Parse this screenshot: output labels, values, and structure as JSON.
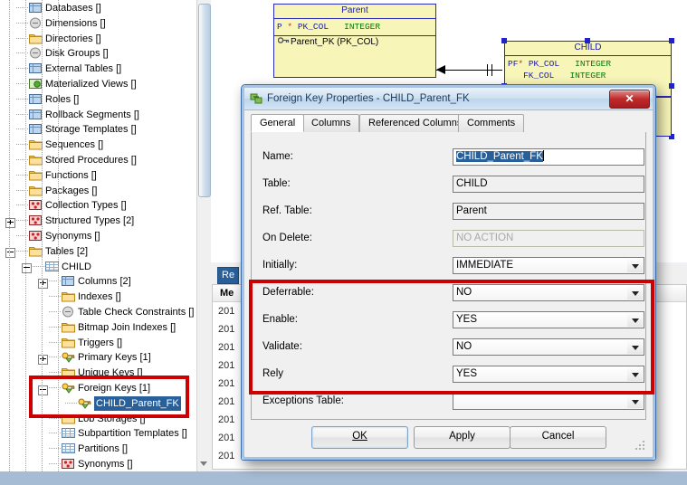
{
  "tree": {
    "items": [
      {
        "label": "Databases []",
        "icon": "databases-icon",
        "indent": 0,
        "toggle": "none",
        "icon_kind": "blue"
      },
      {
        "label": "Dimensions []",
        "icon": "dimensions-icon",
        "indent": 0,
        "toggle": "none",
        "icon_kind": "gray"
      },
      {
        "label": "Directories []",
        "icon": "directories-icon",
        "indent": 0,
        "toggle": "none",
        "icon_kind": "folder"
      },
      {
        "label": "Disk Groups []",
        "icon": "disk-groups-icon",
        "indent": 0,
        "toggle": "none",
        "icon_kind": "gray"
      },
      {
        "label": "External Tables []",
        "icon": "external-tables-icon",
        "indent": 0,
        "toggle": "none",
        "icon_kind": "blue"
      },
      {
        "label": "Materialized Views []",
        "icon": "materialized-views-icon",
        "indent": 0,
        "toggle": "none",
        "icon_kind": "green"
      },
      {
        "label": "Roles []",
        "icon": "roles-icon",
        "indent": 0,
        "toggle": "none",
        "icon_kind": "blue"
      },
      {
        "label": "Rollback Segments []",
        "icon": "rollback-segments-icon",
        "indent": 0,
        "toggle": "none",
        "icon_kind": "blue"
      },
      {
        "label": "Storage Templates []",
        "icon": "storage-templates-icon",
        "indent": 0,
        "toggle": "none",
        "icon_kind": "blue"
      },
      {
        "label": "Sequences []",
        "icon": "sequences-icon",
        "indent": 0,
        "toggle": "none",
        "icon_kind": "folder"
      },
      {
        "label": "Stored Procedures []",
        "icon": "stored-procedures-icon",
        "indent": 0,
        "toggle": "none",
        "icon_kind": "folder"
      },
      {
        "label": "Functions []",
        "icon": "functions-icon",
        "indent": 0,
        "toggle": "none",
        "icon_kind": "folder"
      },
      {
        "label": "Packages []",
        "icon": "packages-icon",
        "indent": 0,
        "toggle": "none",
        "icon_kind": "folder"
      },
      {
        "label": "Collection Types []",
        "icon": "collection-types-icon",
        "indent": 0,
        "toggle": "none",
        "icon_kind": "red"
      },
      {
        "label": "Structured Types [2]",
        "icon": "structured-types-icon",
        "indent": 0,
        "toggle": "plus",
        "icon_kind": "red"
      },
      {
        "label": "Synonyms []",
        "icon": "synonyms-icon",
        "indent": 0,
        "toggle": "none",
        "icon_kind": "red"
      },
      {
        "label": "Tables [2]",
        "icon": "tables-icon",
        "indent": 0,
        "toggle": "minus",
        "icon_kind": "folder"
      },
      {
        "label": "CHILD",
        "icon": "table-icon",
        "indent": 1,
        "toggle": "minus",
        "icon_kind": "grid"
      },
      {
        "label": "Columns [2]",
        "icon": "columns-icon",
        "indent": 2,
        "toggle": "plus",
        "icon_kind": "blue"
      },
      {
        "label": "Indexes []",
        "icon": "indexes-icon",
        "indent": 2,
        "toggle": "none",
        "icon_kind": "folder"
      },
      {
        "label": "Table Check Constraints []",
        "icon": "table-check-constraints-icon",
        "indent": 2,
        "toggle": "none",
        "icon_kind": "gray"
      },
      {
        "label": "Bitmap Join Indexes []",
        "icon": "bitmap-join-indexes-icon",
        "indent": 2,
        "toggle": "none",
        "icon_kind": "folder"
      },
      {
        "label": "Triggers []",
        "icon": "triggers-icon",
        "indent": 2,
        "toggle": "none",
        "icon_kind": "folder"
      },
      {
        "label": "Primary Keys [1]",
        "icon": "primary-keys-icon",
        "indent": 2,
        "toggle": "plus",
        "icon_kind": "key"
      },
      {
        "label": "Unique Keys []",
        "icon": "unique-keys-icon",
        "indent": 2,
        "toggle": "none",
        "icon_kind": "folder"
      },
      {
        "label": "Foreign Keys [1]",
        "icon": "foreign-keys-icon",
        "indent": 2,
        "toggle": "minus",
        "icon_kind": "key"
      },
      {
        "label": "CHILD_Parent_FK",
        "icon": "foreign-key-icon",
        "indent": 3,
        "toggle": "none",
        "icon_kind": "key",
        "selected": true
      },
      {
        "label": "Lob Storages []",
        "icon": "lob-storages-icon",
        "indent": 2,
        "toggle": "none",
        "icon_kind": "folder"
      },
      {
        "label": "Subpartition Templates []",
        "icon": "subpartition-templates-icon",
        "indent": 2,
        "toggle": "none",
        "icon_kind": "grid"
      },
      {
        "label": "Partitions []",
        "icon": "partitions-icon",
        "indent": 2,
        "toggle": "none",
        "icon_kind": "grid"
      },
      {
        "label": "Synonyms []",
        "icon": "synonyms-icon",
        "indent": 2,
        "toggle": "none",
        "icon_kind": "red"
      }
    ]
  },
  "diagram": {
    "parent": {
      "title": "Parent",
      "attributes": [
        {
          "flags": "P",
          "required": "*",
          "name": "PK_COL",
          "type": "INTEGER"
        }
      ],
      "keys": [
        "Parent_PK (PK_COL)"
      ]
    },
    "child": {
      "title": "CHILD",
      "attributes": [
        {
          "flags": "PF",
          "required": "*",
          "name": "PK_COL",
          "type": "INTEGER"
        },
        {
          "flags": "",
          "required": "",
          "name": "FK_COL",
          "type": "INTEGER"
        }
      ],
      "selected": true
    }
  },
  "log": {
    "tab_label": "Re",
    "column_header": "Me",
    "rows": [
      "201",
      "201",
      "201",
      "201",
      "201",
      "201",
      "201",
      "201",
      "201"
    ]
  },
  "dialog": {
    "title": "Foreign Key Properties - CHILD_Parent_FK",
    "close_label": "✕",
    "tabs": [
      {
        "label": "General",
        "active": true
      },
      {
        "label": "Columns",
        "active": false
      },
      {
        "label": "Referenced Columns",
        "active": false
      },
      {
        "label": "Comments",
        "active": false
      }
    ],
    "fields": [
      {
        "label": "Name:",
        "value": "CHILD_Parent_FK",
        "kind": "text-selected"
      },
      {
        "label": "Table:",
        "value": "CHILD",
        "kind": "text-readonly"
      },
      {
        "label": "Ref. Table:",
        "value": "Parent",
        "kind": "text-readonly"
      },
      {
        "label": "On Delete:",
        "value": "NO ACTION",
        "kind": "text-placeholder"
      },
      {
        "label": "Initially:",
        "value": "IMMEDIATE",
        "kind": "select"
      },
      {
        "label": "Deferrable:",
        "value": "NO",
        "kind": "select"
      },
      {
        "label": "Enable:",
        "value": "YES",
        "kind": "select"
      },
      {
        "label": "Validate:",
        "value": "NO",
        "kind": "select"
      },
      {
        "label": "Rely",
        "value": "YES",
        "kind": "select"
      },
      {
        "label": "Exceptions Table:",
        "value": "",
        "kind": "select"
      }
    ],
    "buttons": {
      "ok": "OK",
      "apply": "Apply",
      "cancel": "Cancel"
    }
  },
  "annotations": {
    "highlight_color": "#cc0000",
    "boxes": [
      {
        "name": "highlight-tree-foreign-key"
      },
      {
        "name": "highlight-dialog-constraint-options"
      }
    ]
  }
}
